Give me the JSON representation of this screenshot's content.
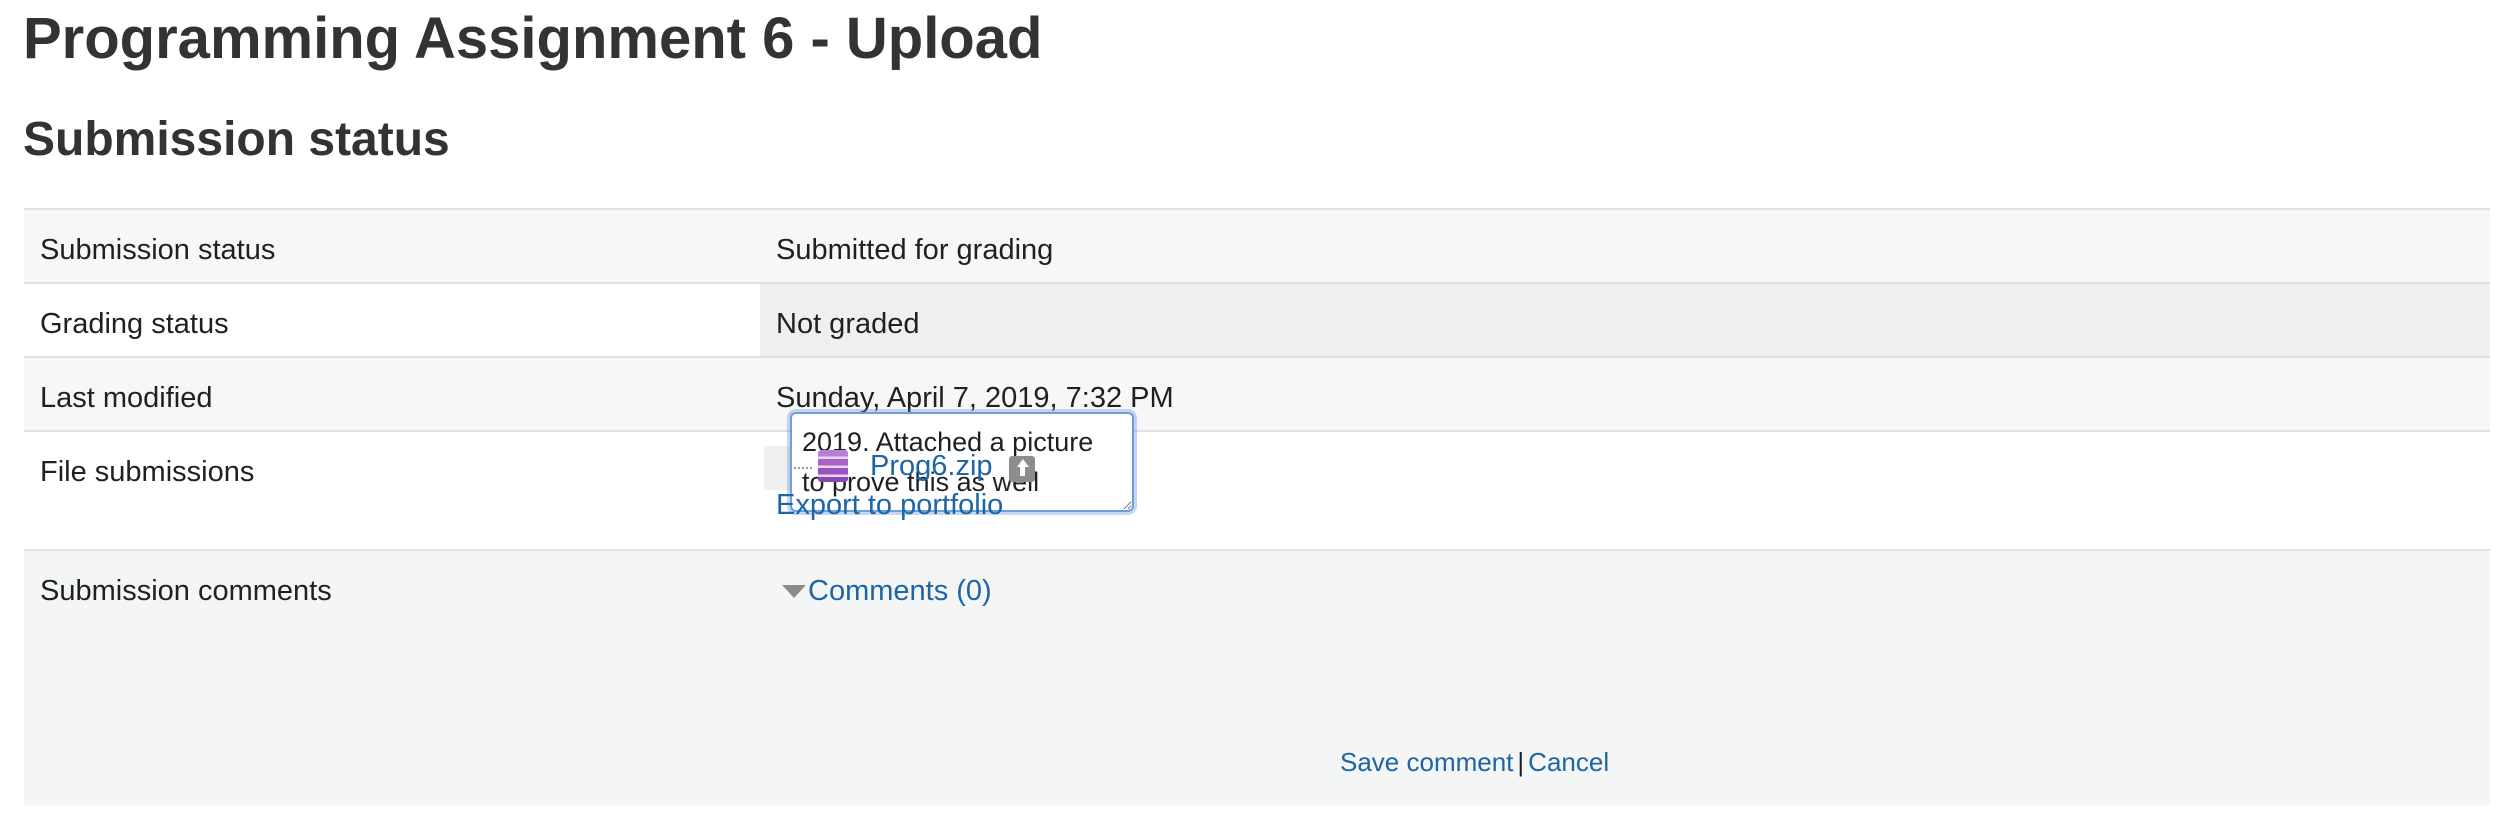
{
  "page": {
    "title": "Programming Assignment 6 - Upload",
    "section_title": "Submission status"
  },
  "rows": [
    {
      "label": "Submission status",
      "value": "Submitted for grading"
    },
    {
      "label": "Grading status",
      "value": "Not graded"
    },
    {
      "label": "Last modified",
      "value": "Sunday, April 7, 2019, 7:32 PM"
    },
    {
      "label": "File submissions",
      "file_name": "Prog6.zip",
      "export_label": "Export to portfolio"
    },
    {
      "label": "Submission comments",
      "comments_toggle": "Comments (0)"
    }
  ],
  "comment_box": {
    "value": "2019. Attached a picture\nto prove this as well"
  },
  "comment_actions": {
    "save_label": "Save comment",
    "separator": "|",
    "cancel_label": "Cancel"
  },
  "icons": {
    "file_type": "archive-icon",
    "portfolio": "portfolio-export-icon",
    "toggle": "triangle-down-icon"
  },
  "colors": {
    "link": "#1d65a5",
    "text": "#1d2125",
    "heading": "#333333",
    "row_odd": "#f7f7f7",
    "row_even": "#ffffff",
    "grading_highlight": "#efefef",
    "border": "#dee2e6"
  }
}
